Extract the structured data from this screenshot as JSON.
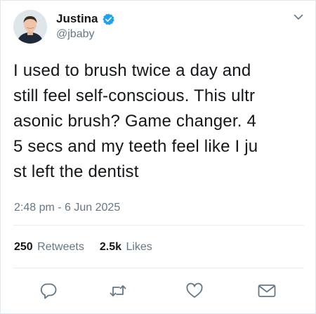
{
  "author": {
    "display_name": "Justina",
    "handle": "@jbaby",
    "verified_icon": "verified-badge-icon",
    "avatar_icon": "avatar"
  },
  "tweet": {
    "lines": [
      "I used to brush twice a day and",
      "still feel self-conscious. This ultr",
      "asonic brush? Game changer. 4",
      "5 secs and my teeth feel like I ju",
      "st left the dentist"
    ],
    "timestamp": "2:48 pm - 6 Jun 2025"
  },
  "stats": {
    "retweets_count": "250",
    "retweets_label": "Retweets",
    "likes_count": "2.5k",
    "likes_label": "Likes"
  },
  "actions": {
    "icons": [
      "reply-icon",
      "retweet-icon",
      "like-icon",
      "direct-message-icon"
    ]
  },
  "colors": {
    "text": "#14171a",
    "muted": "#657786",
    "verified": "#1da1f2",
    "divider": "#e6ecf0",
    "icon": "#657786"
  }
}
